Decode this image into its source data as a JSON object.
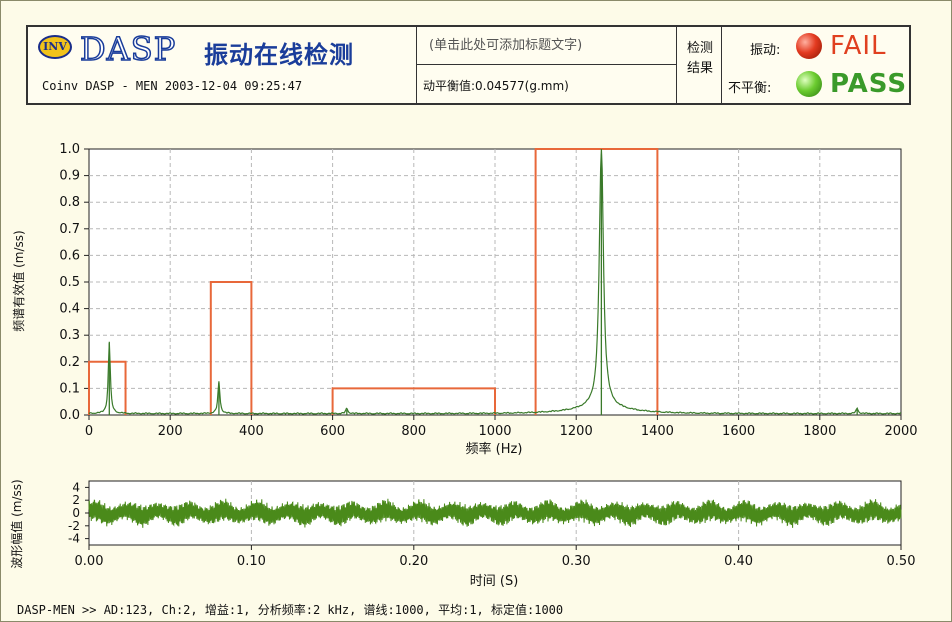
{
  "header": {
    "logo_badge": "INV",
    "logo_text": "DASP",
    "app_title": "振动在线检测",
    "info": "Coinv DASP - MEN  2003-12-04 09:25:47",
    "title_placeholder": "(单击此处可添加标题文字)",
    "balance_value": "动平衡值:0.04577(g.mm)",
    "result_label": "检测结果",
    "vibration_label": "振动:",
    "vibration_status": "FAIL",
    "unbalance_label": "不平衡:",
    "unbalance_status": "PASS",
    "colors": {
      "fail": "#e04020",
      "pass": "#3a9a2a"
    }
  },
  "footer": "DASP-MEN >> AD:123, Ch:2, 增益:1, 分析频率:2 kHz, 谱线:1000, 平均:1, 标定值:1000",
  "chart_data": [
    {
      "type": "line",
      "ylabel": "频谱有效值 (m/ss)",
      "xlabel": "频率 (Hz)",
      "xlim": [
        0,
        2000
      ],
      "ylim": [
        0,
        1.0
      ],
      "xticks": [
        0,
        200,
        400,
        600,
        800,
        1000,
        1200,
        1400,
        1600,
        1800,
        2000
      ],
      "yticks": [
        0.0,
        0.1,
        0.2,
        0.3,
        0.4,
        0.5,
        0.6,
        0.7,
        0.8,
        0.9,
        1.0
      ],
      "ytick_labels": [
        "0.0",
        "0.1",
        "0.2",
        "0.3",
        "0.4",
        "0.5",
        "0.6",
        "0.7",
        "0.8",
        "0.9",
        "1.0"
      ],
      "grid": true,
      "limit_bands": [
        {
          "x": [
            0,
            90
          ],
          "y": 0.2
        },
        {
          "x": [
            300,
            400
          ],
          "y": 0.5
        },
        {
          "x": [
            600,
            1000
          ],
          "y": 0.1
        },
        {
          "x": [
            1100,
            1400
          ],
          "y": 1.0
        }
      ],
      "peaks": [
        {
          "x": 50,
          "y": 0.27
        },
        {
          "x": 320,
          "y": 0.12
        },
        {
          "x": 635,
          "y": 0.02
        },
        {
          "x": 1262,
          "y": 0.98
        },
        {
          "x": 1892,
          "y": 0.02
        }
      ],
      "colors": {
        "spectrum": "#3a7a2a",
        "limit": "#e8683a"
      }
    },
    {
      "type": "line",
      "ylabel": "波形幅值 (m/ss)",
      "xlabel": "时间 (S)",
      "xlim": [
        0,
        0.5
      ],
      "ylim": [
        -5,
        5
      ],
      "xticks": [
        0.0,
        0.1,
        0.2,
        0.3,
        0.4,
        0.5
      ],
      "xtick_labels": [
        "0.00",
        "0.10",
        "0.20",
        "0.30",
        "0.40",
        "0.50"
      ],
      "yticks": [
        4,
        2,
        0,
        -2,
        -4
      ],
      "grid": true,
      "amplitude": 2.4,
      "colors": {
        "waveform": "#4a8a1a"
      }
    }
  ]
}
